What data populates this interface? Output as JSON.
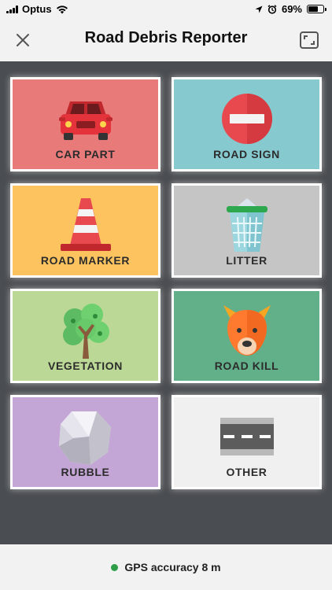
{
  "status_bar": {
    "carrier": "Optus",
    "battery_percent": "69%",
    "battery_level": 0.69
  },
  "header": {
    "title": "Road Debris Reporter"
  },
  "categories": [
    {
      "label": "CAR PART",
      "icon": "car-icon",
      "color": "#e87a7a"
    },
    {
      "label": "ROAD SIGN",
      "icon": "no-entry-sign-icon",
      "color": "#86c9cf"
    },
    {
      "label": "ROAD MARKER",
      "icon": "traffic-cone-icon",
      "color": "#fdc35f"
    },
    {
      "label": "LITTER",
      "icon": "trash-bin-icon",
      "color": "#c5c5c5"
    },
    {
      "label": "VEGETATION",
      "icon": "tree-icon",
      "color": "#bcd896"
    },
    {
      "label": "ROAD KILL",
      "icon": "fox-icon",
      "color": "#62b08a"
    },
    {
      "label": "RUBBLE",
      "icon": "rock-icon",
      "color": "#c3a6d6"
    },
    {
      "label": "OTHER",
      "icon": "road-icon",
      "color": "#f0f0f0"
    }
  ],
  "footer": {
    "gps_text": "GPS accuracy 8 m",
    "gps_status_color": "#2e9e48"
  }
}
